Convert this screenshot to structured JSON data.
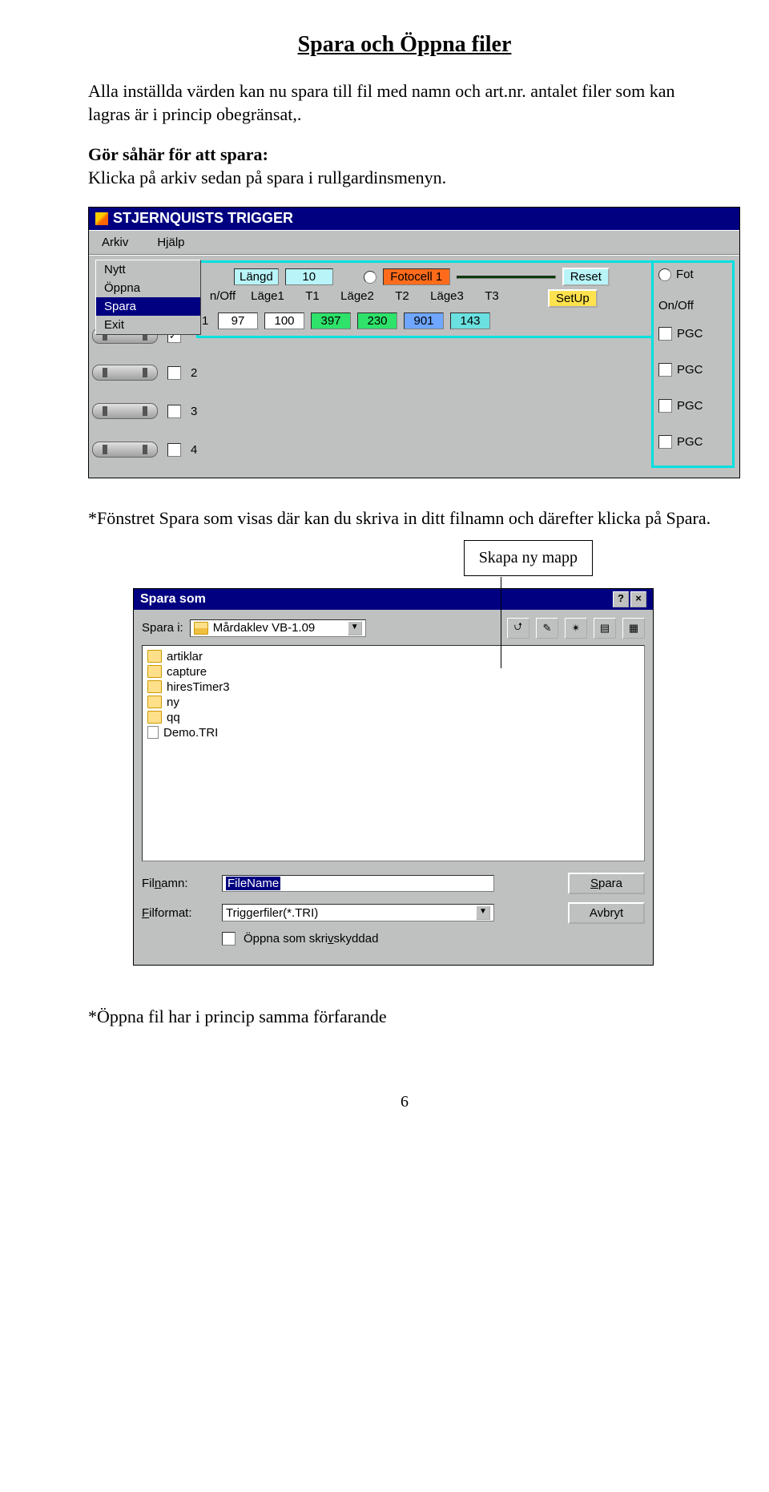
{
  "doc": {
    "title": "Spara och Öppna filer",
    "p1": "Alla inställda värden kan nu spara till fil med namn och art.nr. antalet filer som kan lagras är i princip obegränsat,.",
    "p2_bold": "Gör såhär för att spara",
    "p2_rest": "Klicka på arkiv sedan på spara i rullgardinsmenyn.",
    "p3": "*Fönstret Spara som visas där kan du skriva in ditt filnamn och därefter klicka på Spara.",
    "callout": "Skapa ny mapp",
    "p4": "*Öppna fil har i princip samma förfarande",
    "page": "6"
  },
  "app1": {
    "title": "STJERNQUISTS TRIGGER",
    "menu": {
      "arkiv": "Arkiv",
      "hjalp": "Hjälp"
    },
    "dropdown": {
      "nytt": "Nytt",
      "oppna": "Öppna",
      "spara": "Spara",
      "exit": "Exit"
    },
    "toprow": {
      "langd_lbl": "Längd",
      "langd_val": "10",
      "foto_lbl": "Fotocell 1",
      "reset": "Reset",
      "fot": "Fot"
    },
    "headers": {
      "n_off": "n/Off",
      "lage1": "Läge1",
      "t1": "T1",
      "lage2": "Läge2",
      "t2": "T2",
      "lage3": "Läge3",
      "t3": "T3",
      "setup": "SetUp",
      "onoff": "On/Off"
    },
    "rows": [
      {
        "n": "1",
        "v": [
          "97",
          "100",
          "397",
          "230",
          "901",
          "143"
        ],
        "pgc": "PGC",
        "checked": true
      },
      {
        "n": "2",
        "v": [],
        "pgc": "PGC",
        "checked": false
      },
      {
        "n": "3",
        "v": [],
        "pgc": "PGC",
        "checked": false
      },
      {
        "n": "4",
        "v": [],
        "pgc": "PGC",
        "checked": false
      }
    ]
  },
  "dlg": {
    "title": "Spara som",
    "save_in_lbl": "Spara i:",
    "save_in_val": "Mårdaklev VB-1.09",
    "files": [
      {
        "name": "artiklar",
        "type": "folder"
      },
      {
        "name": "capture",
        "type": "folder"
      },
      {
        "name": "hiresTimer3",
        "type": "folder"
      },
      {
        "name": "ny",
        "type": "folder"
      },
      {
        "name": "qq",
        "type": "folder"
      },
      {
        "name": "Demo.TRI",
        "type": "file"
      }
    ],
    "filename_lbl": "Filnamn:",
    "filename_val": "FileName",
    "format_lbl": "Filformat:",
    "format_val": "Triggerfiler(*.TRI)",
    "readonly_lbl": "Öppna som skrivskyddad",
    "btn_save": "Spara",
    "btn_cancel": "Avbryt"
  }
}
